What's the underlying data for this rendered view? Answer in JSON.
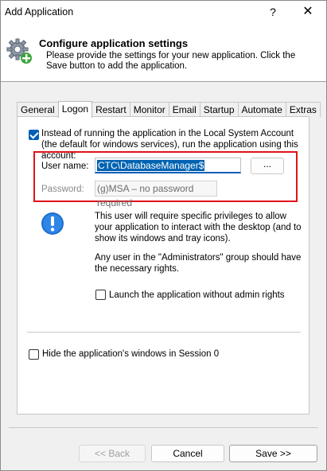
{
  "window": {
    "title": "Add Application",
    "help_label": "?",
    "close_label": "✕"
  },
  "header": {
    "title": "Configure application settings",
    "description": "Please provide the settings for your new application. Click the Save button to add the application."
  },
  "tabs": [
    {
      "label": "General"
    },
    {
      "label": "Logon",
      "active": true
    },
    {
      "label": "Restart"
    },
    {
      "label": "Monitor"
    },
    {
      "label": "Email"
    },
    {
      "label": "Startup"
    },
    {
      "label": "Automate"
    },
    {
      "label": "Extras"
    }
  ],
  "logon": {
    "run_as_label": "Instead of running the application in the Local System Account (the default for windows services), run the application using this account:",
    "run_as_checked": true,
    "username_label": "User name:",
    "username_value": "CTC\\DatabaseManager$",
    "browse_label": "...",
    "password_label": "Password:",
    "password_value": "(g)MSA – no password required",
    "info_text_1": "This user will require specific privileges to allow your application to interact with the desktop (and to show its windows and tray icons).",
    "info_text_2": "Any user in the \"Administrators\" group should have the necessary rights.",
    "no_admin_label": "Launch the application without admin rights",
    "no_admin_checked": false,
    "hide_session0_label": "Hide the application's windows in Session 0",
    "hide_session0_checked": false
  },
  "footer": {
    "back_label": "<< Back",
    "cancel_label": "Cancel",
    "save_label": "Save >>"
  },
  "colors": {
    "accent": "#005fb8",
    "highlight_box": "#e0121a",
    "selection": "#0063b1"
  }
}
